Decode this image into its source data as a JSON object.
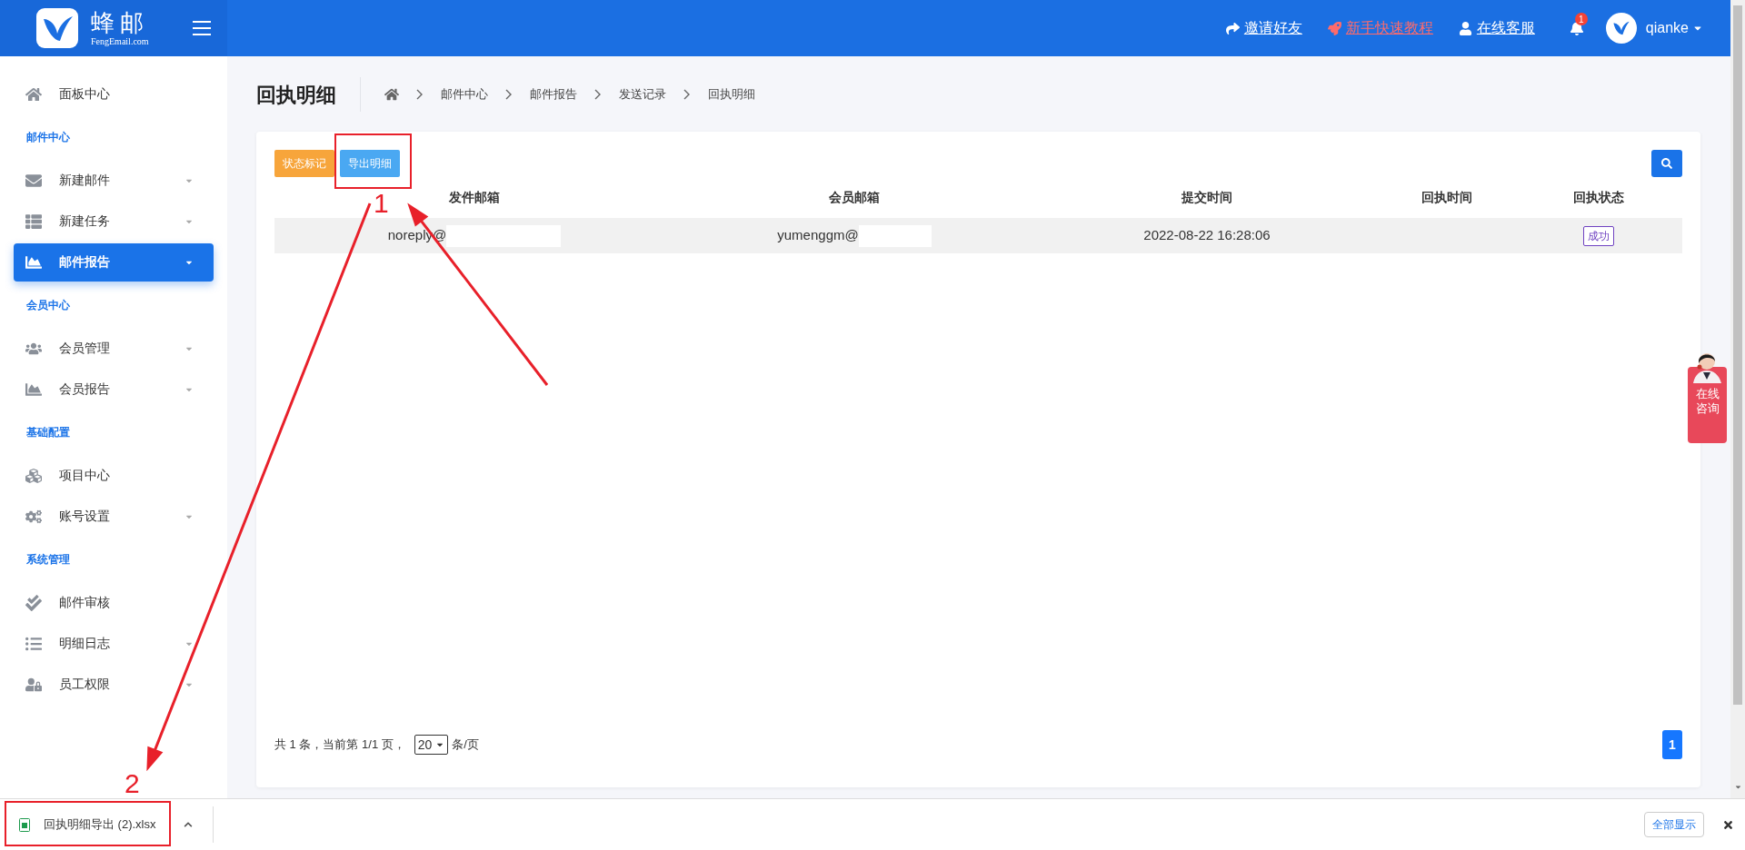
{
  "header": {
    "logo_title": "蜂邮",
    "logo_subtitle": "FengEmail.com",
    "links": [
      {
        "label": "邀请好友",
        "kind": "invite"
      },
      {
        "label": "新手快速教程",
        "kind": "tutorial"
      },
      {
        "label": "在线客服",
        "kind": "support"
      }
    ],
    "notification_count": "1",
    "username": "qianke"
  },
  "sidebar": {
    "items": [
      {
        "kind": "item",
        "label": "面板中心",
        "expandable": false,
        "selected": false
      },
      {
        "kind": "section",
        "label": "邮件中心"
      },
      {
        "kind": "item",
        "label": "新建邮件",
        "expandable": true,
        "selected": false
      },
      {
        "kind": "item",
        "label": "新建任务",
        "expandable": true,
        "selected": false
      },
      {
        "kind": "item",
        "label": "邮件报告",
        "expandable": true,
        "selected": true
      },
      {
        "kind": "section",
        "label": "会员中心"
      },
      {
        "kind": "item",
        "label": "会员管理",
        "expandable": true,
        "selected": false
      },
      {
        "kind": "item",
        "label": "会员报告",
        "expandable": true,
        "selected": false
      },
      {
        "kind": "section",
        "label": "基础配置"
      },
      {
        "kind": "item",
        "label": "项目中心",
        "expandable": false,
        "selected": false
      },
      {
        "kind": "item",
        "label": "账号设置",
        "expandable": true,
        "selected": false
      },
      {
        "kind": "section",
        "label": "系统管理"
      },
      {
        "kind": "item",
        "label": "邮件审核",
        "expandable": false,
        "selected": false
      },
      {
        "kind": "item",
        "label": "明细日志",
        "expandable": true,
        "selected": false
      },
      {
        "kind": "item",
        "label": "员工权限",
        "expandable": true,
        "selected": false
      }
    ]
  },
  "page": {
    "title": "回执明细",
    "breadcrumb": [
      "邮件中心",
      "邮件报告",
      "发送记录",
      "回执明细"
    ]
  },
  "toolbar": {
    "buttons": [
      {
        "label": "状态标记",
        "kind": "warning"
      },
      {
        "label": "导出明细",
        "kind": "info"
      }
    ]
  },
  "table": {
    "columns": [
      "发件邮箱",
      "会员邮箱",
      "提交时间",
      "回执时间",
      "回执状态"
    ],
    "rows": [
      {
        "sender": "noreply@",
        "member": "yumenggm@",
        "submitted": "2022-08-22 16:28:06",
        "status": "成功"
      }
    ]
  },
  "pagination": {
    "summary": "共 1 条，当前第 1/1 页，",
    "page_size": "20",
    "page_size_unit": "条/页",
    "pages": [
      {
        "label": "1",
        "selected": true
      }
    ]
  },
  "chat_widget": {
    "label": "在线咨询"
  },
  "download_bar": {
    "file_name": "回执明细导出 (2).xlsx",
    "show_all": "全部显示"
  },
  "annotations": [
    {
      "label": "1"
    },
    {
      "label": "2"
    }
  ]
}
